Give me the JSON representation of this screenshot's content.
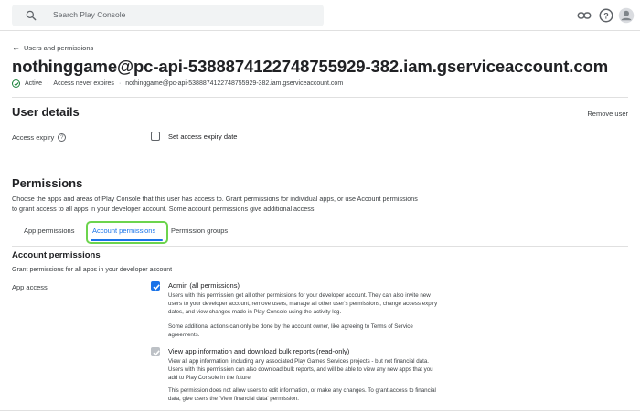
{
  "search": {
    "placeholder": "Search Play Console",
    "icon": "search-icon"
  },
  "topbar_icons": [
    "link-icon",
    "help-icon",
    "account-avatar-icon"
  ],
  "breadcrumb": {
    "back_label": "Users and permissions"
  },
  "page_title": "nothinggame@pc-api-5388874122748755929-382.iam.gserviceaccount.com",
  "meta": {
    "status": "Active",
    "expiry": "Access never expires",
    "email": "nothinggame@pc-api-5388874122748755929-382.iam.gserviceaccount.com",
    "status_color": "#188038"
  },
  "user_details": {
    "heading": "User details",
    "remove_label": "Remove user",
    "access_expiry_label": "Access expiry",
    "set_expiry_label": "Set access expiry date"
  },
  "permissions": {
    "heading": "Permissions",
    "description_line1": "Choose the apps and areas of Play Console that this user has access to. Grant permissions for individual apps, or use Account permissions",
    "description_line2": "to grant access to all apps in your developer account. Some account permissions give additional access.",
    "tabs": [
      {
        "label": "App permissions",
        "active": false
      },
      {
        "label": "Account permissions",
        "active": true
      },
      {
        "label": "Permission groups",
        "active": false
      }
    ]
  },
  "account_permissions": {
    "heading": "Account permissions",
    "subtext": "Grant permissions for all apps in your developer account",
    "app_access_label": "App access",
    "items": [
      {
        "title": "Admin (all permissions)",
        "checked": true,
        "disabled": false,
        "desc1": "Users with this permission get all other permissions for your developer account. They can also invite new users to your developer account, remove users, manage all other user's permissions, change access expiry dates, and view changes made in Play Console using the activity log.",
        "desc2": "Some additional actions can only be done by the account owner, like agreeing to Terms of Service agreements."
      },
      {
        "title": "View app information and download bulk reports (read-only)",
        "checked": true,
        "disabled": true,
        "desc1": "View all app information, including any associated Play Games Services projects - but not financial data. Users with this permission can also download bulk reports, and will be able to view any new apps that you add to Play Console in the future.",
        "desc2": "This permission does not allow users to edit information, or make any changes. To grant access to financial data, give users the 'View financial data' permission."
      }
    ]
  },
  "colors": {
    "accent": "#1a73e8",
    "highlight": "#6cd44d"
  }
}
